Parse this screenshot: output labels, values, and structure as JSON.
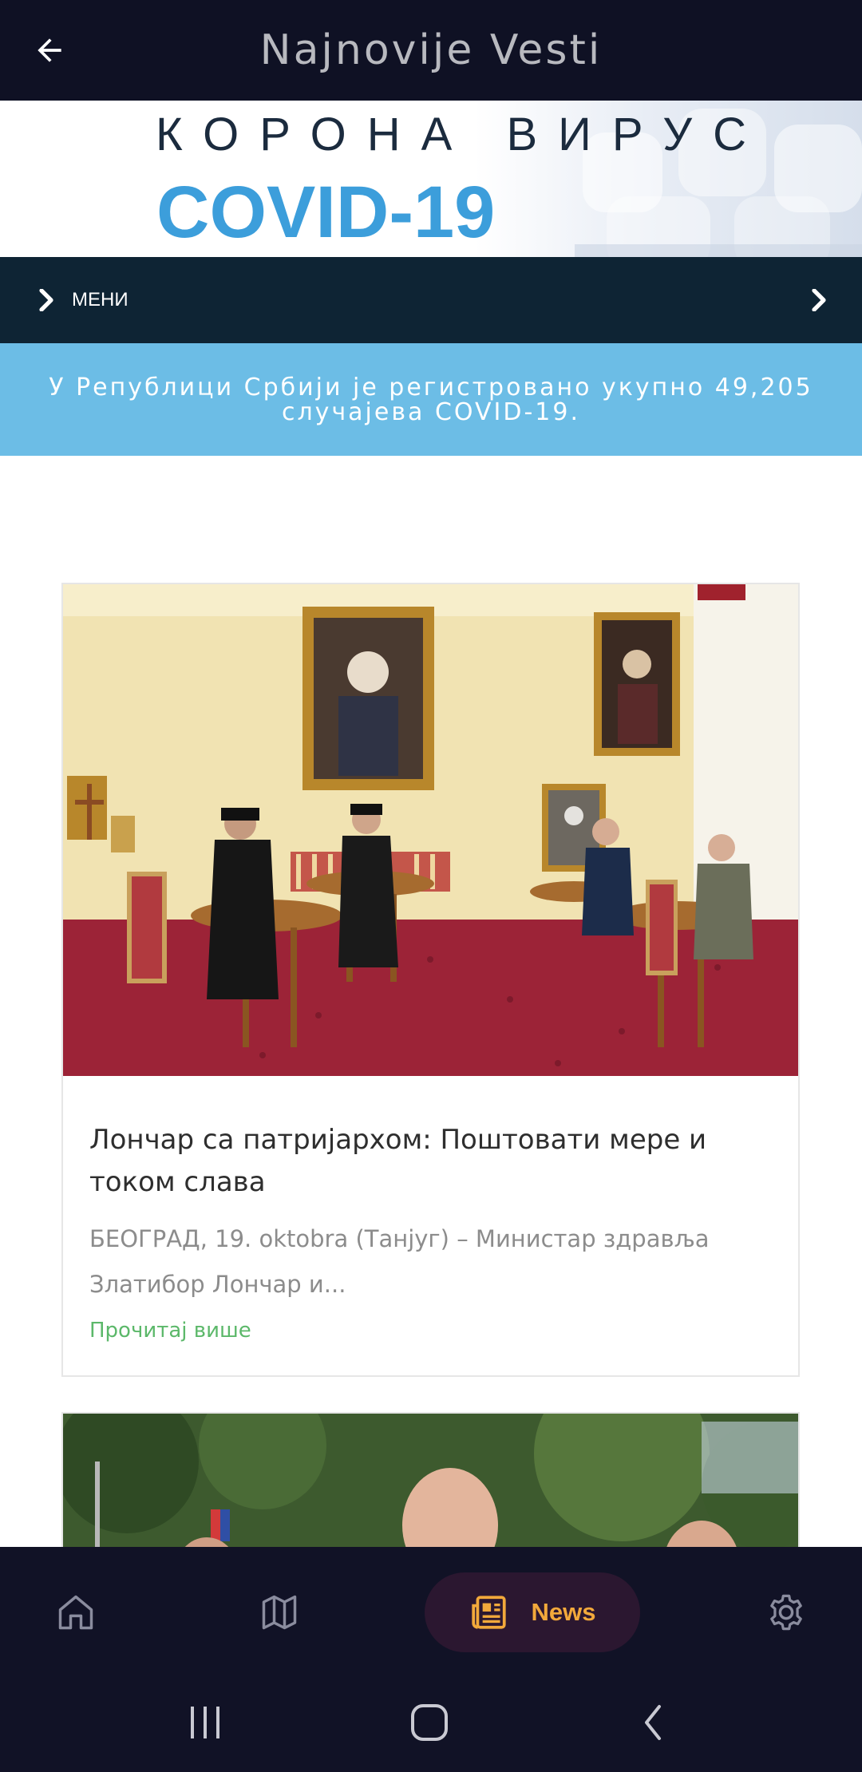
{
  "app_bar": {
    "title": "Najnovije Vesti",
    "back_icon": "arrow-left-icon"
  },
  "banner": {
    "kicker": "КОРОНА ВИРУС",
    "title": "COVID-19",
    "accent_color": "#3c9edb"
  },
  "menu": {
    "label": "МЕНИ",
    "toggle_icon": "chevron-right-icon",
    "expand_icon": "chevron-right-icon"
  },
  "info": {
    "text": "У Републици Србији је регистровано укупно 49,205 случајева COVID-19.",
    "background": "#6cbde6"
  },
  "articles": [
    {
      "title": "Лончар са патријархом: Поштовати мере и током слава",
      "excerpt": "БЕОГРАД, 19. oktobra (Танјуг) – Министар здравља Златибор Лончар и...",
      "read_more": "Прочитај више"
    },
    {
      "title": "",
      "excerpt": "",
      "read_more": ""
    }
  ],
  "bottom_nav": {
    "items": [
      {
        "id": "home",
        "icon": "home-icon",
        "label": ""
      },
      {
        "id": "map",
        "icon": "map-icon",
        "label": ""
      },
      {
        "id": "news",
        "icon": "newspaper-icon",
        "label": "News",
        "active": true
      },
      {
        "id": "settings",
        "icon": "gear-icon",
        "label": ""
      }
    ],
    "active_color": "#f2a93b",
    "active_pill_color": "#2b1730"
  },
  "system_nav": {
    "buttons": [
      "recents-icon",
      "home-circle-icon",
      "back-chevron-icon"
    ]
  }
}
